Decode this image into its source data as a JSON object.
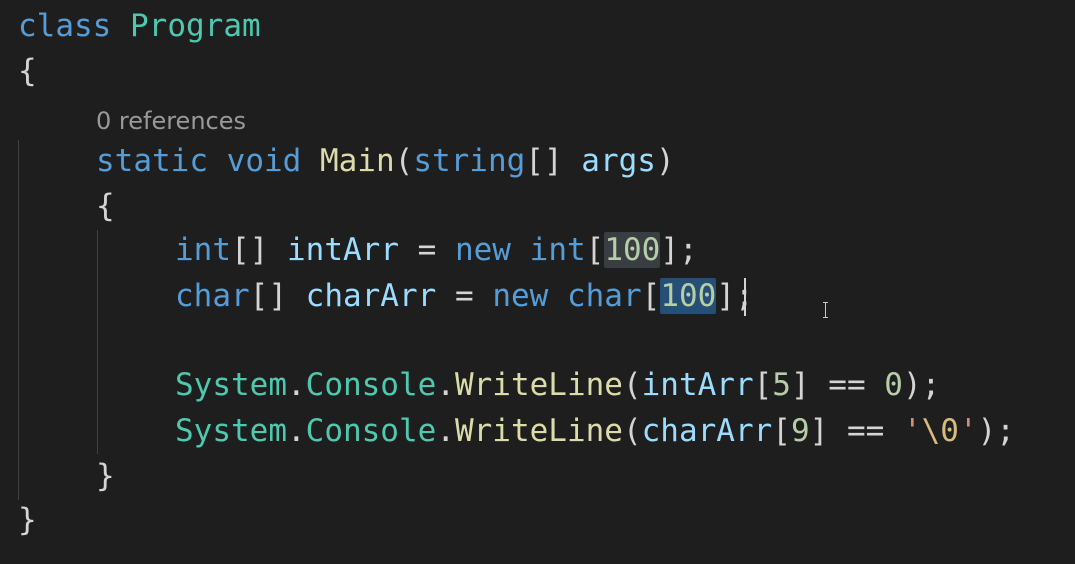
{
  "code": {
    "line1": {
      "kw": "class",
      "sp": " ",
      "name": "Program"
    },
    "line2": {
      "brace": "{"
    },
    "codelens": "0 references",
    "line3": {
      "static": "static",
      "sp1": " ",
      "void": "void",
      "sp2": " ",
      "name": "Main",
      "open": "(",
      "type": "string",
      "brk": "[]",
      "sp3": " ",
      "param": "args",
      "close": ")"
    },
    "line4": {
      "brace": "{"
    },
    "line5": {
      "type": "int",
      "brk": "[]",
      "sp1": " ",
      "var": "intArr",
      "eq": " = ",
      "new": "new",
      "sp2": " ",
      "type2": "int",
      "open": "[",
      "num": "100",
      "close": "];"
    },
    "line6": {
      "type": "char",
      "brk": "[]",
      "sp1": " ",
      "var": "charArr",
      "eq": " = ",
      "new": "new",
      "sp2": " ",
      "type2": "char",
      "open": "[",
      "num": "100",
      "close": "];"
    },
    "line7": {
      "ns": "System",
      "dot1": ".",
      "cls": "Console",
      "dot2": ".",
      "fn": "WriteLine",
      "open": "(",
      "var": "intArr",
      "idxo": "[",
      "idx": "5",
      "idxc": "]",
      "op": " == ",
      "num": "0",
      "close": ");"
    },
    "line8": {
      "ns": "System",
      "dot1": ".",
      "cls": "Console",
      "dot2": ".",
      "fn": "WriteLine",
      "open": "(",
      "var": "charArr",
      "idxo": "[",
      "idx": "9",
      "idxc": "]",
      "op": " == ",
      "q1": "'",
      "esc": "\\0",
      "q2": "'",
      "close": ");"
    },
    "line9": {
      "brace": "}"
    },
    "line10": {
      "brace": "}"
    }
  },
  "colors": {
    "background": "#1e1e1e",
    "keyword": "#569cd6",
    "type": "#4ec9b0",
    "function": "#dcdcaa",
    "variable": "#9cdcfe",
    "number": "#b5cea8",
    "string": "#ce9178",
    "selection": "#264f78"
  }
}
